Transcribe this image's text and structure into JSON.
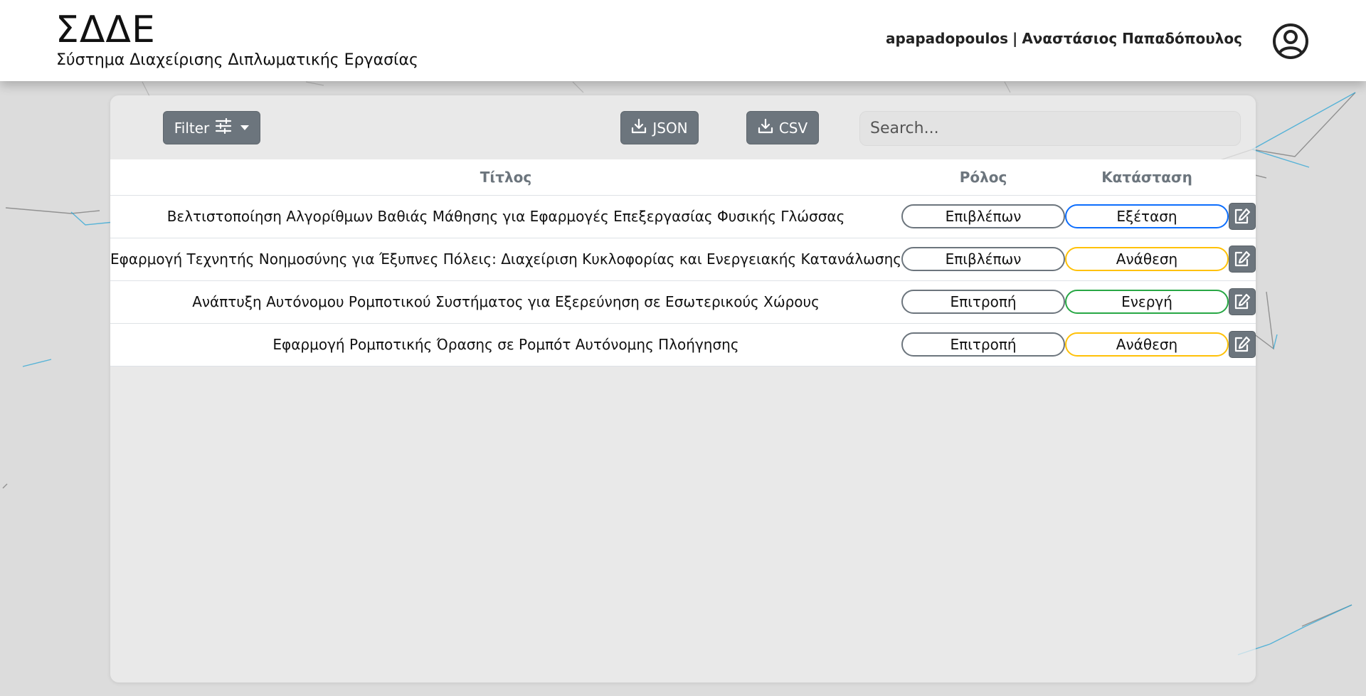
{
  "header": {
    "app_title": "ΣΔΔΕ",
    "app_subtitle": "Σύστημα Διαχείρισης Διπλωματικής Εργασίας",
    "username": "apapadopoulos",
    "separator": "|",
    "full_name": "Αναστάσιος Παπαδόπουλος",
    "avatar_icon": "user-circle-icon"
  },
  "toolbar": {
    "filter_label": "Filter",
    "filter_icon": "sliders-icon",
    "json_label": "JSON",
    "csv_label": "CSV",
    "download_icon": "download-icon",
    "search_placeholder": "Search...",
    "search_value": ""
  },
  "table": {
    "headers": {
      "title": "Τίτλος",
      "role": "Ρόλος",
      "status": "Κατάσταση",
      "action": ""
    },
    "rows": [
      {
        "title": "Βελτιστοποίηση Αλγορίθμων Βαθιάς Μάθησης για Εφαρμογές Επεξεργασίας Φυσικής Γλώσσας",
        "role": "Επιβλέπων",
        "status": "Εξέταση",
        "status_color": "#0d6efd"
      },
      {
        "title": "Εφαρμογή Τεχνητής Νοημοσύνης για Έξυπνες Πόλεις: Διαχείριση Κυκλοφορίας και Ενεργειακής Κατανάλωσης",
        "role": "Επιβλέπων",
        "status": "Ανάθεση",
        "status_color": "#ffc107"
      },
      {
        "title": "Ανάπτυξη Αυτόνομου Ρομποτικού Συστήματος για Εξερεύνηση σε Εσωτερικούς Χώρους",
        "role": "Επιτροπή",
        "status": "Ενεργή",
        "status_color": "#28a745"
      },
      {
        "title": "Εφαρμογή Ρομποτικής Όρασης σε Ρομπότ Αυτόνομης Πλοήγησης",
        "role": "Επιτροπή",
        "status": "Ανάθεση",
        "status_color": "#ffc107"
      }
    ],
    "role_border_color": "#6c757d",
    "edit_icon": "edit-icon"
  },
  "colors": {
    "button_gray": "#6c757d",
    "header_bg": "#ffffff",
    "page_bg": "#dcdcdc"
  }
}
